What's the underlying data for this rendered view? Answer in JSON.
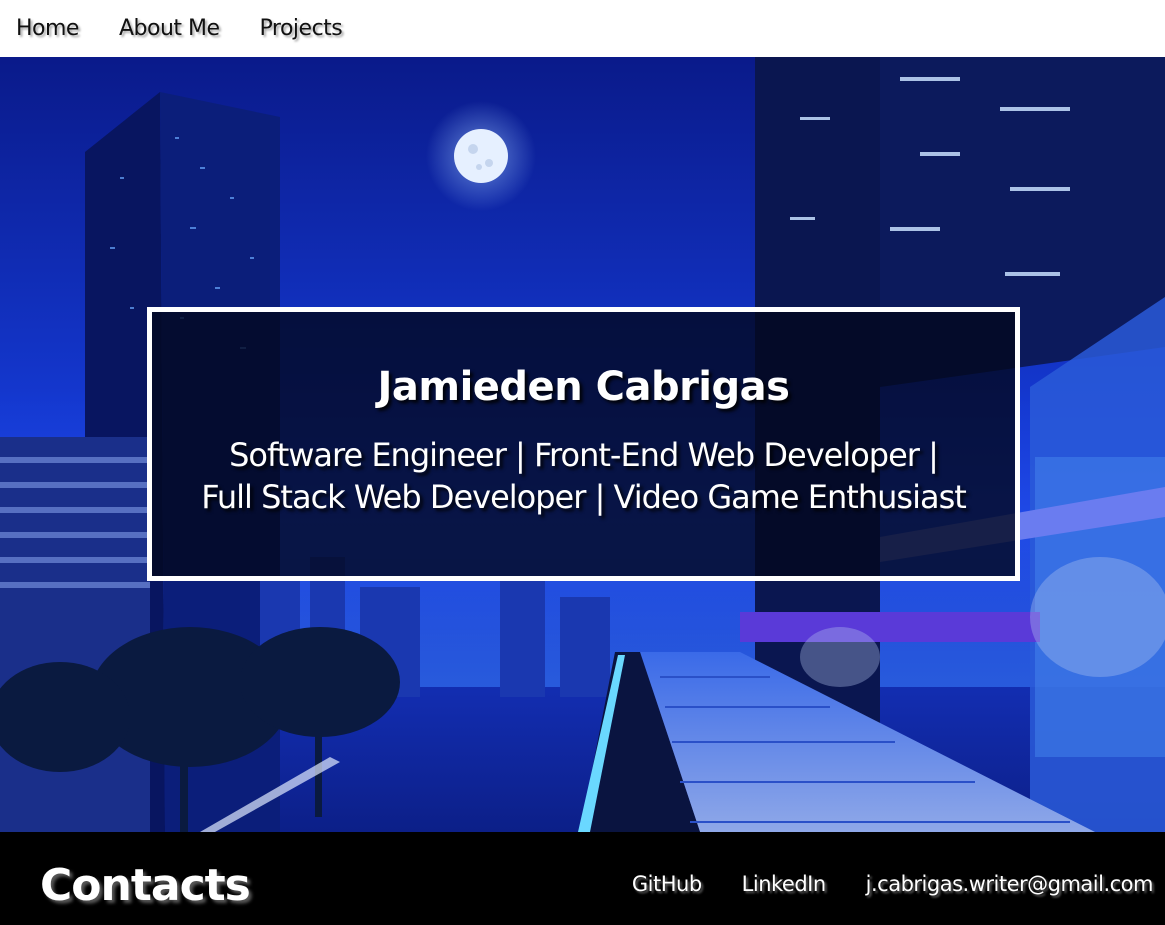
{
  "nav": {
    "items": [
      {
        "label": "Home"
      },
      {
        "label": "About Me"
      },
      {
        "label": "Projects"
      }
    ]
  },
  "hero": {
    "name": "Jamieden Cabrigas",
    "roles_line1": "Software Engineer | Front-End Web Developer |",
    "roles_line2": "Full Stack Web Developer | Video Game Enthusiast",
    "background": "futuristic night city skyline with moon"
  },
  "footer": {
    "title": "Contacts",
    "links": [
      {
        "label": "GitHub"
      },
      {
        "label": "LinkedIn"
      },
      {
        "label": "j.cabrigas.writer@gmail.com"
      }
    ]
  },
  "colors": {
    "nav_bg": "#ffffff",
    "footer_bg": "#000000",
    "hero_blue": "#1438d0",
    "text_light": "#ffffff"
  }
}
